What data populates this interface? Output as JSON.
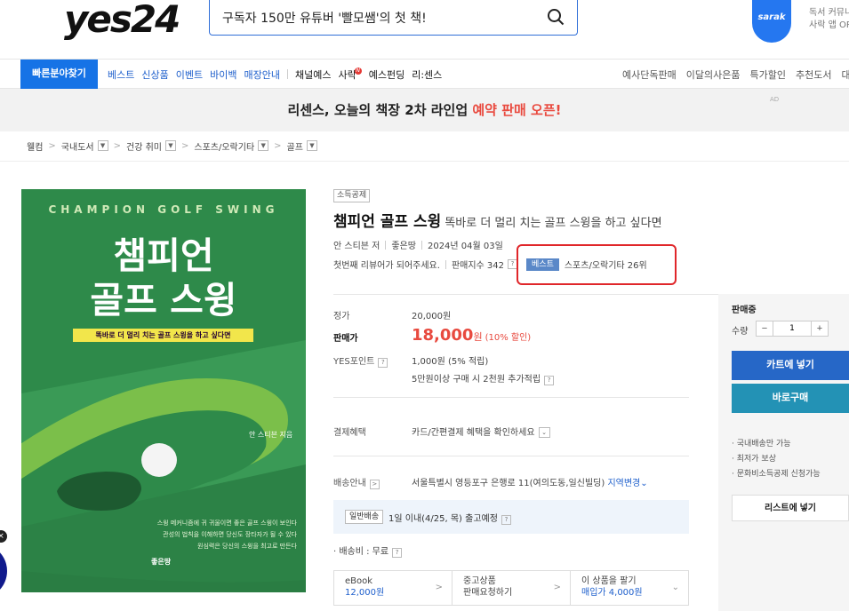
{
  "header": {
    "logo": "yes24",
    "search_value": "구독자 150만 유튜버 '빨모쌤'의 첫 책!",
    "sarak_badge": "sarak",
    "sarak_line1": "독서 커뮤니",
    "sarak_line2": "사락 앱 OP"
  },
  "nav": {
    "quick": "빠른분야찾기",
    "left_items": [
      {
        "label": "베스트",
        "style": "blue"
      },
      {
        "label": "신상품",
        "style": "blue"
      },
      {
        "label": "이벤트",
        "style": "blue"
      },
      {
        "label": "바이백",
        "style": "blue"
      },
      {
        "label": "매장안내",
        "style": "blue"
      },
      {
        "label": "채널예스",
        "style": "dark"
      },
      {
        "label": "사락",
        "style": "dark"
      },
      {
        "label": "예스펀딩",
        "style": "dark"
      },
      {
        "label": "리:센스",
        "style": "dark"
      }
    ],
    "new_dot": "N",
    "right_items": [
      "예사단독판매",
      "이달의사은품",
      "특가할인",
      "추천도서",
      "대한"
    ]
  },
  "banner": {
    "text_before": "리센스, 오늘의 책장 2차 라인업 ",
    "text_highlight": "예약 판매 오픈!",
    "ad_mark": "AD"
  },
  "breadcrumb": [
    "웰컴",
    "국내도서",
    "건강 취미",
    "스포츠/오락기타",
    "골프"
  ],
  "cover": {
    "top_text": "CHAMPION GOLF SWING",
    "title_line1": "챔피언",
    "title_line2": "골프 스윙",
    "subtitle": "똑바로 더 멀리 치는 골프 스윙을 하고 싶다면",
    "author": "안 스티븐 지음",
    "blurb_line1": "스윙 메커니즘에 귀 귀울이면 좋은 골프 스윙이 보인다",
    "blurb_line2": "관성의 법칙을 이해하면 당신도 장타자가 될 수 있다",
    "blurb_line3": "원심력은 당신의 스윙을 최고로 만든다",
    "publisher": "좋은땅"
  },
  "product": {
    "tag": "소득공제",
    "title": "챔피언 골프 스윙",
    "subtitle": "똑바로 더 멀리 치는 골프 스윙을 하고 싶다면",
    "author": "안 스티븐 저",
    "publisher": "좋은땅",
    "date": "2024년 04월 03일",
    "review": "첫번째 리뷰어가 되어주세요.",
    "sales_index": "판매지수 342",
    "best_flag": "베스트",
    "best_rank": "스포츠/오락기타 26위"
  },
  "price": {
    "list_label": "정가",
    "list_value": "20,000원",
    "sale_label": "판매가",
    "sale_value": "18,000",
    "sale_unit": "원",
    "discount": "(10% 할인)",
    "point_label": "YES포인트",
    "point_value": "1,000원 (5% 적립)",
    "point_extra": "5만원이상 구매 시 2천원 추가적립",
    "benefit_label": "결제혜택",
    "benefit_value": "카드/간편결제 혜택을 확인하세요",
    "delivery_label": "배송안내",
    "address": "서울특별시 영등포구 은행로 11(여의도동,일신빌딩)",
    "address_change": "지역변경",
    "ship_badge": "일반배송",
    "ship_text": "1일 이내(4/25, 목) 출고예정",
    "ship_fee": "· 배송비 : 무료"
  },
  "options": [
    {
      "line1": "eBook",
      "line2": "12,000원",
      "line2_blue": true
    },
    {
      "line1": "중고상품",
      "line2": "판매요청하기",
      "line2_blue": false
    },
    {
      "line1": "이 상품을 팔기",
      "line2": "매입가 4,000원",
      "line2_blue": true
    }
  ],
  "side": {
    "status": "판매중",
    "qty_label": "수량",
    "qty_value": "1",
    "cart": "카트에 넣기",
    "buy": "바로구매",
    "notes": [
      "· 국내배송만 가능",
      "· 최저가 보상",
      "· 문화비소득공제 신청가능"
    ],
    "list": "리스트에 넣기"
  },
  "colors": {
    "brand_blue": "#1673e6",
    "sale_red": "#e84a3f",
    "cover_green": "#2e8a4a",
    "highlight_red": "#e0262a"
  }
}
